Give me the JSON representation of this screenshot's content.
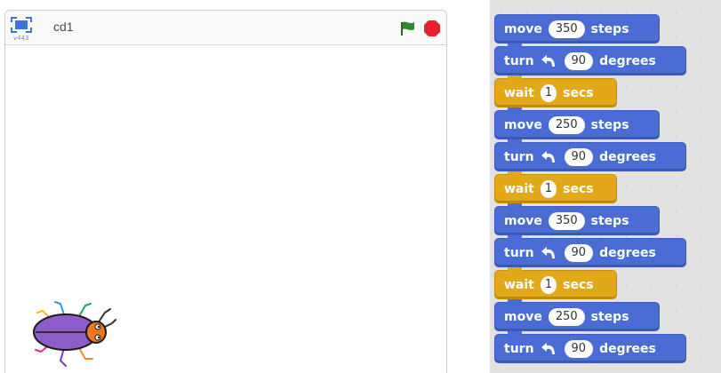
{
  "stage": {
    "version": "v443",
    "title": "cd1"
  },
  "colors": {
    "motion": "#4a6cd4",
    "control": "#e1a91a",
    "flag": "#2e8b2e",
    "stop": "#e8212c"
  },
  "blocks": [
    {
      "type": "move",
      "kw": "move",
      "value": "350",
      "unit": "steps"
    },
    {
      "type": "turn",
      "kw": "turn",
      "icon": "rotate-left-icon",
      "value": "90",
      "unit": "degrees"
    },
    {
      "type": "wait",
      "kw": "wait",
      "value": "1",
      "unit": "secs"
    },
    {
      "type": "move",
      "kw": "move",
      "value": "250",
      "unit": "steps"
    },
    {
      "type": "turn",
      "kw": "turn",
      "icon": "rotate-left-icon",
      "value": "90",
      "unit": "degrees"
    },
    {
      "type": "wait",
      "kw": "wait",
      "value": "1",
      "unit": "secs"
    },
    {
      "type": "move",
      "kw": "move",
      "value": "350",
      "unit": "steps"
    },
    {
      "type": "turn",
      "kw": "turn",
      "icon": "rotate-left-icon",
      "value": "90",
      "unit": "degrees"
    },
    {
      "type": "wait",
      "kw": "wait",
      "value": "1",
      "unit": "secs"
    },
    {
      "type": "move",
      "kw": "move",
      "value": "250",
      "unit": "steps"
    },
    {
      "type": "turn",
      "kw": "turn",
      "icon": "rotate-left-icon",
      "value": "90",
      "unit": "degrees"
    }
  ]
}
